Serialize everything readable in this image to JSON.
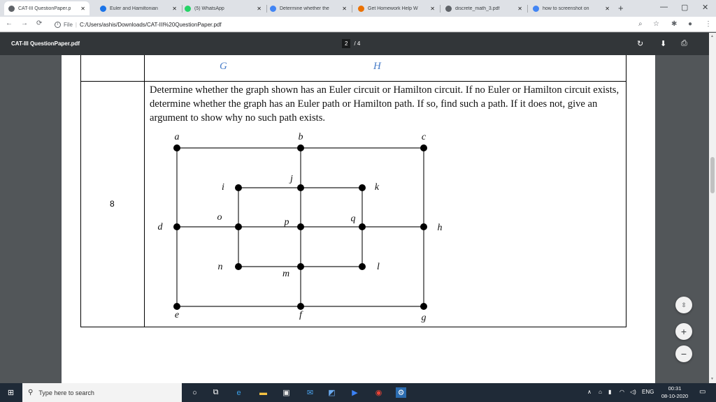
{
  "browser": {
    "tabs": [
      {
        "title": "CAT-III QuestionPaper.p",
        "icon": "globe-icon",
        "icon_color": "#5f6368",
        "active": true
      },
      {
        "title": "Euler and Hamiltonian",
        "icon": "l-site-icon",
        "icon_color": "#1a73e8",
        "active": false
      },
      {
        "title": "(5) WhatsApp",
        "icon": "whatsapp-icon",
        "icon_color": "#25d366",
        "active": false
      },
      {
        "title": "Determine whether the",
        "icon": "google-icon",
        "icon_color": "#4285f4",
        "active": false
      },
      {
        "title": "Get Homework Help W",
        "icon": "chegg-icon",
        "icon_color": "#eb7100",
        "active": false
      },
      {
        "title": "discrete_math_3.pdf",
        "icon": "globe-icon",
        "icon_color": "#5f6368",
        "active": false
      },
      {
        "title": "how to screenshot on",
        "icon": "google-icon",
        "icon_color": "#4285f4",
        "active": false
      }
    ],
    "new_tab": "+",
    "address": {
      "scheme_label": "File",
      "url": "C:/Users/ashis/Downloads/CAT-III%20QuestionPaper.pdf"
    }
  },
  "pdf_viewer": {
    "file_title": "CAT-III QuestionPaper.pdf",
    "current_page": "2",
    "page_separator": "/",
    "total_pages": "4"
  },
  "page": {
    "header_left": "G",
    "header_right": "H",
    "question_number": "8",
    "question_text": "Determine whether the graph shown has an Euler circuit or Hamilton circuit. If no Euler or Hamilton circuit exists, determine whether the graph has an Euler path or Hamilton path. If so, find such a path. If it does not, give an argument to show why no such path exists."
  },
  "graph": {
    "vertex_labels": [
      "a",
      "b",
      "c",
      "d",
      "e",
      "f",
      "g",
      "h",
      "i",
      "j",
      "k",
      "l",
      "m",
      "n",
      "o",
      "p",
      "q"
    ],
    "edges": [
      [
        "a",
        "b"
      ],
      [
        "b",
        "c"
      ],
      [
        "a",
        "d"
      ],
      [
        "d",
        "e"
      ],
      [
        "c",
        "h"
      ],
      [
        "h",
        "g"
      ],
      [
        "e",
        "f"
      ],
      [
        "f",
        "g"
      ],
      [
        "d",
        "o"
      ],
      [
        "o",
        "p"
      ],
      [
        "p",
        "q"
      ],
      [
        "q",
        "h"
      ],
      [
        "b",
        "j"
      ],
      [
        "j",
        "p"
      ],
      [
        "p",
        "m"
      ],
      [
        "m",
        "f"
      ],
      [
        "i",
        "j"
      ],
      [
        "j",
        "k"
      ],
      [
        "k",
        "l"
      ],
      [
        "n",
        "m"
      ],
      [
        "m",
        "l"
      ],
      [
        "i",
        "o"
      ],
      [
        "o",
        "n"
      ]
    ]
  },
  "zoom_controls": {
    "fit": "fit-page-icon",
    "zoom_in": "+",
    "zoom_out": "−"
  },
  "taskbar": {
    "search_placeholder": "Type here to search",
    "language": "ENG",
    "time": "00:31",
    "date": "08-10-2020"
  }
}
